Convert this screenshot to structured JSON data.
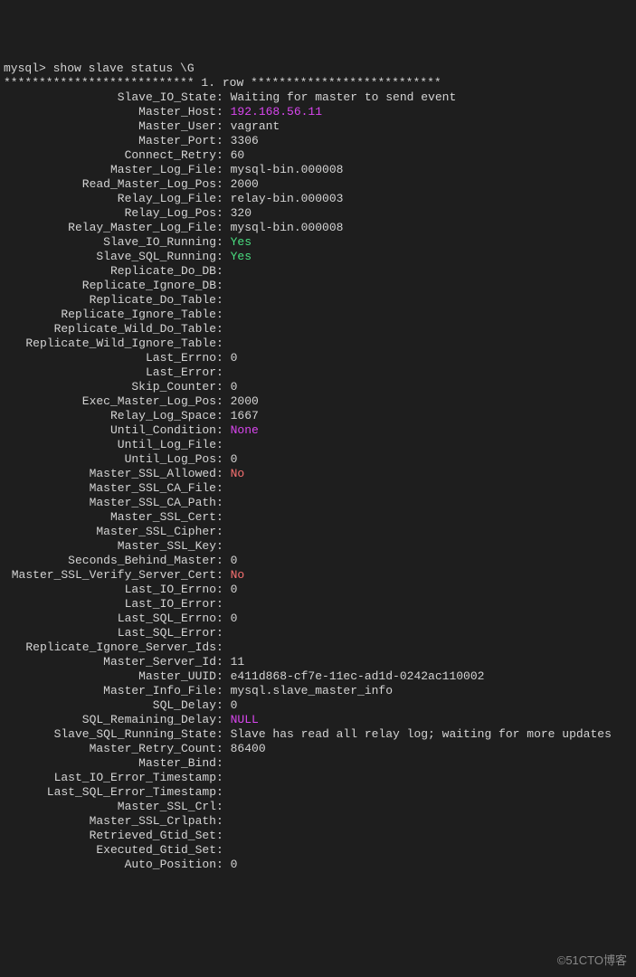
{
  "prompt": "mysql> show slave status \\G",
  "row_header": "*************************** 1. row ***************************",
  "watermark": "©51CTO博客",
  "fields": [
    {
      "label": "Slave_IO_State",
      "value": "Waiting for master to send event",
      "cls": ""
    },
    {
      "label": "Master_Host",
      "value": "192.168.56.11",
      "cls": "magenta"
    },
    {
      "label": "Master_User",
      "value": "vagrant",
      "cls": ""
    },
    {
      "label": "Master_Port",
      "value": "3306",
      "cls": ""
    },
    {
      "label": "Connect_Retry",
      "value": "60",
      "cls": ""
    },
    {
      "label": "Master_Log_File",
      "value": "mysql-bin.000008",
      "cls": ""
    },
    {
      "label": "Read_Master_Log_Pos",
      "value": "2000",
      "cls": ""
    },
    {
      "label": "Relay_Log_File",
      "value": "relay-bin.000003",
      "cls": ""
    },
    {
      "label": "Relay_Log_Pos",
      "value": "320",
      "cls": ""
    },
    {
      "label": "Relay_Master_Log_File",
      "value": "mysql-bin.000008",
      "cls": ""
    },
    {
      "label": "Slave_IO_Running",
      "value": "Yes",
      "cls": "green"
    },
    {
      "label": "Slave_SQL_Running",
      "value": "Yes",
      "cls": "green"
    },
    {
      "label": "Replicate_Do_DB",
      "value": "",
      "cls": ""
    },
    {
      "label": "Replicate_Ignore_DB",
      "value": "",
      "cls": ""
    },
    {
      "label": "Replicate_Do_Table",
      "value": "",
      "cls": ""
    },
    {
      "label": "Replicate_Ignore_Table",
      "value": "",
      "cls": ""
    },
    {
      "label": "Replicate_Wild_Do_Table",
      "value": "",
      "cls": ""
    },
    {
      "label": "Replicate_Wild_Ignore_Table",
      "value": "",
      "cls": ""
    },
    {
      "label": "Last_Errno",
      "value": "0",
      "cls": ""
    },
    {
      "label": "Last_Error",
      "value": "",
      "cls": ""
    },
    {
      "label": "Skip_Counter",
      "value": "0",
      "cls": ""
    },
    {
      "label": "Exec_Master_Log_Pos",
      "value": "2000",
      "cls": ""
    },
    {
      "label": "Relay_Log_Space",
      "value": "1667",
      "cls": ""
    },
    {
      "label": "Until_Condition",
      "value": "None",
      "cls": "magenta"
    },
    {
      "label": "Until_Log_File",
      "value": "",
      "cls": ""
    },
    {
      "label": "Until_Log_Pos",
      "value": "0",
      "cls": ""
    },
    {
      "label": "Master_SSL_Allowed",
      "value": "No",
      "cls": "red"
    },
    {
      "label": "Master_SSL_CA_File",
      "value": "",
      "cls": ""
    },
    {
      "label": "Master_SSL_CA_Path",
      "value": "",
      "cls": ""
    },
    {
      "label": "Master_SSL_Cert",
      "value": "",
      "cls": ""
    },
    {
      "label": "Master_SSL_Cipher",
      "value": "",
      "cls": ""
    },
    {
      "label": "Master_SSL_Key",
      "value": "",
      "cls": ""
    },
    {
      "label": "Seconds_Behind_Master",
      "value": "0",
      "cls": ""
    },
    {
      "label": "Master_SSL_Verify_Server_Cert",
      "value": "No",
      "cls": "red"
    },
    {
      "label": "Last_IO_Errno",
      "value": "0",
      "cls": ""
    },
    {
      "label": "Last_IO_Error",
      "value": "",
      "cls": ""
    },
    {
      "label": "Last_SQL_Errno",
      "value": "0",
      "cls": ""
    },
    {
      "label": "Last_SQL_Error",
      "value": "",
      "cls": ""
    },
    {
      "label": "Replicate_Ignore_Server_Ids",
      "value": "",
      "cls": ""
    },
    {
      "label": "Master_Server_Id",
      "value": "11",
      "cls": ""
    },
    {
      "label": "Master_UUID",
      "value": "e411d868-cf7e-11ec-ad1d-0242ac110002",
      "cls": ""
    },
    {
      "label": "Master_Info_File",
      "value": "mysql.slave_master_info",
      "cls": ""
    },
    {
      "label": "SQL_Delay",
      "value": "0",
      "cls": ""
    },
    {
      "label": "SQL_Remaining_Delay",
      "value": "NULL",
      "cls": "magenta"
    },
    {
      "label": "Slave_SQL_Running_State",
      "value": "Slave has read all relay log; waiting for more updates",
      "cls": ""
    },
    {
      "label": "Master_Retry_Count",
      "value": "86400",
      "cls": ""
    },
    {
      "label": "Master_Bind",
      "value": "",
      "cls": ""
    },
    {
      "label": "Last_IO_Error_Timestamp",
      "value": "",
      "cls": ""
    },
    {
      "label": "Last_SQL_Error_Timestamp",
      "value": "",
      "cls": ""
    },
    {
      "label": "Master_SSL_Crl",
      "value": "",
      "cls": ""
    },
    {
      "label": "Master_SSL_Crlpath",
      "value": "",
      "cls": ""
    },
    {
      "label": "Retrieved_Gtid_Set",
      "value": "",
      "cls": ""
    },
    {
      "label": "Executed_Gtid_Set",
      "value": "",
      "cls": ""
    },
    {
      "label": "Auto_Position",
      "value": "0",
      "cls": ""
    }
  ]
}
